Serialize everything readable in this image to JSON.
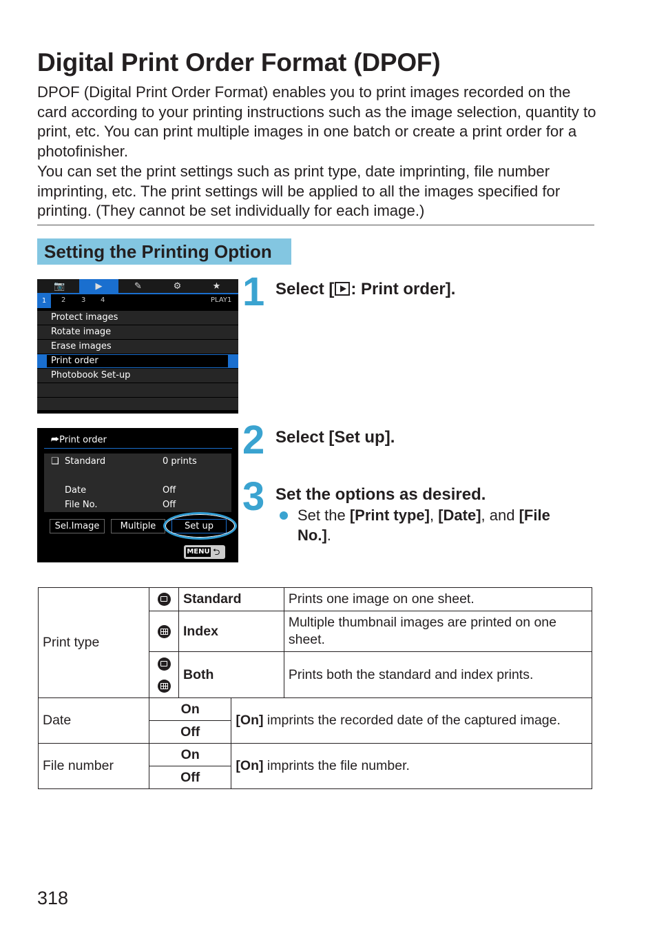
{
  "page": {
    "title": "Digital Print Order Format (DPOF)",
    "intro": [
      "DPOF (Digital Print Order Format) enables you to print images recorded on the card according to your printing instructions such as the image selection, quantity to print, etc. You can print multiple images in one batch or create a print order for a photofinisher.",
      "You can set the print settings such as print type, date imprinting, file number imprinting, etc. The print settings will be applied to all the images specified for printing. (They cannot be set individually for each image.)"
    ],
    "section_heading": "Setting the Printing Option",
    "page_number": "318"
  },
  "screen1": {
    "tabs": [
      {
        "icon": "camera-icon",
        "glyph": "📷"
      },
      {
        "icon": "playback-icon",
        "glyph": "▶",
        "active": true
      },
      {
        "icon": "wrench-icon",
        "glyph": "✎"
      },
      {
        "icon": "custom-function-icon",
        "glyph": "⚙"
      },
      {
        "icon": "star-icon",
        "glyph": "★"
      }
    ],
    "subtabs": [
      "1",
      "2",
      "3",
      "4"
    ],
    "tab_label": "PLAY1",
    "items": [
      "Protect images",
      "Rotate image",
      "Erase images",
      "Print order",
      "Photobook Set-up",
      "",
      ""
    ],
    "selected_index": 3
  },
  "screen2": {
    "title": "Print order",
    "print_type": "Standard",
    "prints": "0 prints",
    "date_label": "Date",
    "date_value": "Off",
    "fileno_label": "File No.",
    "fileno_value": "Off",
    "buttons": [
      "Sel.Image",
      "Multiple",
      "Set up"
    ],
    "menu_key": "MENU",
    "back_glyph": "⮌"
  },
  "steps": [
    {
      "num": "1",
      "pre": "Select [",
      "post": ": Print order]."
    },
    {
      "num": "2",
      "text": "Select [Set up]."
    },
    {
      "num": "3",
      "text": "Set the options as desired.",
      "bullet": {
        "t1": "Set the ",
        "b1": "[Print type]",
        "t2": ", ",
        "b2": "[Date]",
        "t3": ", and ",
        "b3": "[File No.]",
        "t4": "."
      }
    }
  ],
  "table": {
    "print_type": {
      "label": "Print type",
      "rows": [
        {
          "name": "Standard",
          "desc": "Prints one image on one sheet."
        },
        {
          "name": "Index",
          "desc": "Multiple thumbnail images are printed on one sheet."
        },
        {
          "name": "Both",
          "desc": "Prints both the standard and index prints."
        }
      ]
    },
    "date": {
      "label": "Date",
      "on": "On",
      "off": "Off",
      "desc_bold": "[On]",
      "desc": " imprints the recorded date of the captured image."
    },
    "file_number": {
      "label": "File number",
      "on": "On",
      "off": "Off",
      "desc_bold": "[On]",
      "desc": " imprints the file number."
    }
  }
}
